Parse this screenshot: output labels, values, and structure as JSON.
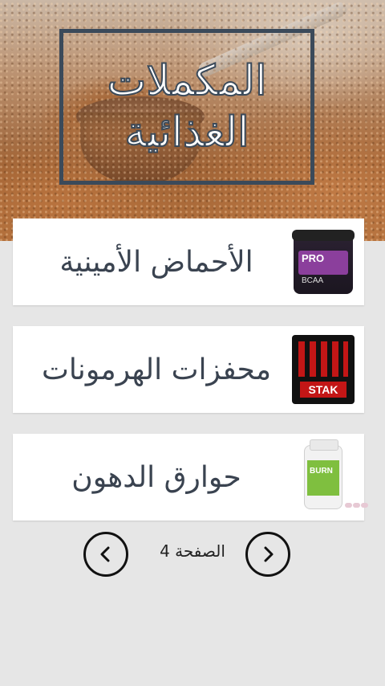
{
  "header": {
    "title_line1": "المكملات",
    "title_line2": "الغذائية"
  },
  "categories": [
    {
      "label": "الأحماض الأمينية",
      "thumb_icon": "pro-bcaa-tub",
      "thumb_text": "PRO",
      "thumb_subtext": "BCAA"
    },
    {
      "label": "محفزات الهرمونات",
      "thumb_icon": "animal-stak-box",
      "thumb_text": "STAK"
    },
    {
      "label": "حوارق الدهون",
      "thumb_icon": "burn-bottle",
      "thumb_text": "BURN"
    }
  ],
  "pager": {
    "page_text": "الصفحة 4",
    "prev_icon": "chevron-left-icon",
    "next_icon": "chevron-right-icon"
  },
  "colors": {
    "background": "#e6e6e6",
    "card": "#ffffff",
    "title_stroke": "#3b4a5a",
    "label_text": "#3a4350"
  }
}
